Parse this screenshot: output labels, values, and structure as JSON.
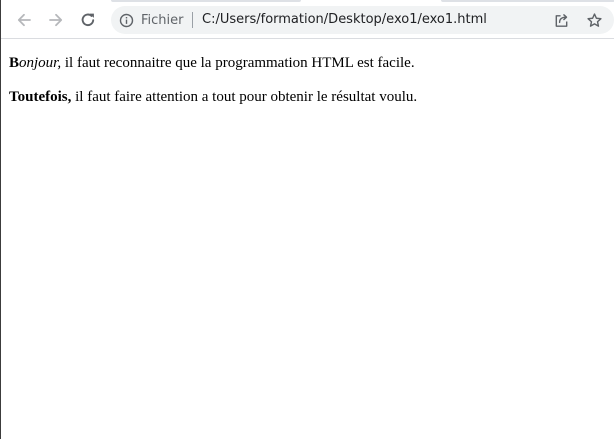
{
  "browser": {
    "site_info_label": "Fichier",
    "url": "C:/Users/formation/Desktop/exo1/exo1.html",
    "icons": {
      "back": "arrow-left-icon",
      "forward": "arrow-right-icon",
      "reload": "reload-icon",
      "info": "info-icon",
      "share": "share-icon",
      "bookmark": "star-icon"
    }
  },
  "page": {
    "paragraph1": {
      "bold_initial": "B",
      "italic_rest": "onjour,",
      "rest": " il faut reconnaitre que la programmation HTML est facile."
    },
    "paragraph2": {
      "bold_lead": "Toutefois,",
      "rest": " il faut faire attention a tout pour obtenir le résultat voulu."
    }
  }
}
